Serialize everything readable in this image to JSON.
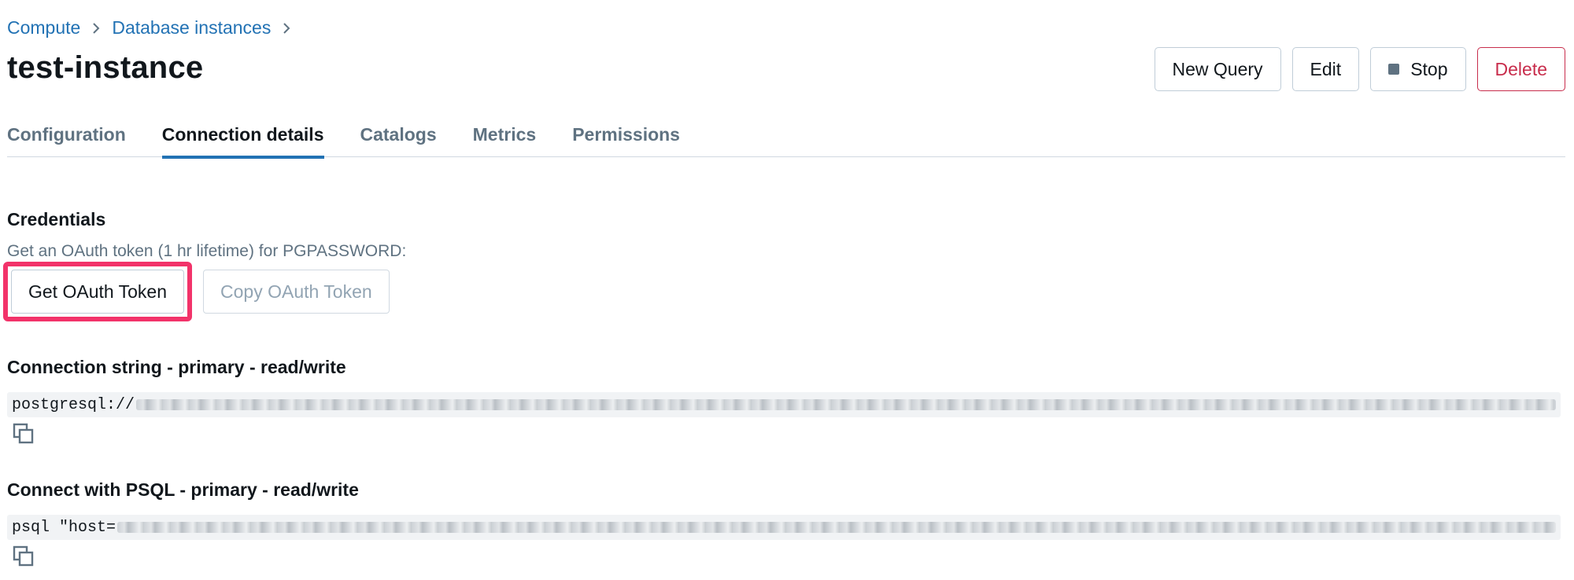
{
  "breadcrumb": {
    "items": [
      "Compute",
      "Database instances"
    ]
  },
  "page": {
    "title": "test-instance"
  },
  "actions": {
    "new_query": "New Query",
    "edit": "Edit",
    "stop": "Stop",
    "delete": "Delete"
  },
  "tabs": [
    {
      "label": "Configuration"
    },
    {
      "label": "Connection details",
      "active": true
    },
    {
      "label": "Catalogs"
    },
    {
      "label": "Metrics"
    },
    {
      "label": "Permissions"
    }
  ],
  "credentials": {
    "title": "Credentials",
    "hint": "Get an OAuth token (1 hr lifetime) for PGPASSWORD:",
    "get_token": "Get OAuth Token",
    "copy_token": "Copy OAuth Token"
  },
  "connection_string": {
    "title": "Connection string - primary - read/write",
    "prefix": "postgresql://"
  },
  "psql": {
    "title": "Connect with PSQL - primary - read/write",
    "prefix": "psql \"host="
  },
  "colors": {
    "link": "#2272b4",
    "danger": "#c82d4c",
    "highlight": "#f2336a",
    "muted": "#5f7281"
  }
}
